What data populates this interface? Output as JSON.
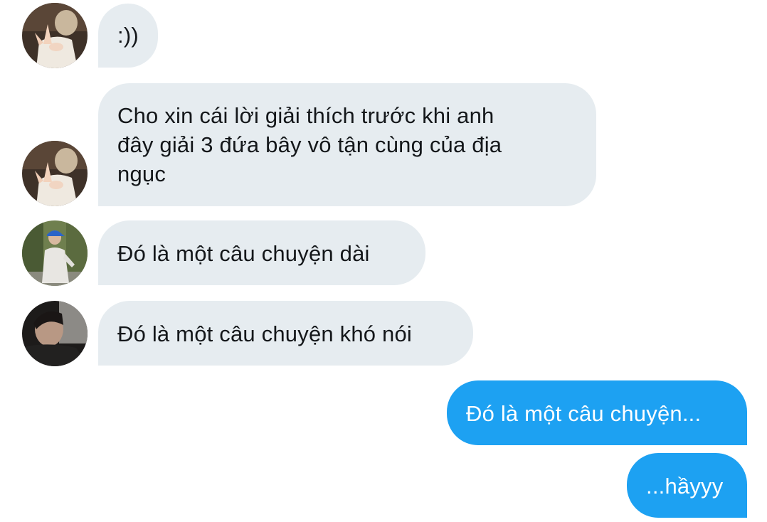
{
  "conversation": {
    "messages": [
      {
        "direction": "incoming",
        "sender_avatar": "avatar-hands",
        "text": ":))"
      },
      {
        "direction": "incoming",
        "sender_avatar": "avatar-hands",
        "text": "Cho xin cái lời giải thích trước khi anh đây giải 3 đứa bây vô tận cùng của địa ngục"
      },
      {
        "direction": "incoming",
        "sender_avatar": "avatar-blue-cap",
        "text": "Đó là một câu chuyện dài"
      },
      {
        "direction": "incoming",
        "sender_avatar": "avatar-dark-portrait",
        "text": "Đó là một câu chuyện khó nói"
      },
      {
        "direction": "outgoing",
        "text": "Đó là một câu chuyện..."
      },
      {
        "direction": "outgoing",
        "text": "...hầyyy"
      }
    ]
  },
  "colors": {
    "incoming_bubble": "#e6ecf0",
    "incoming_text": "#14171a",
    "outgoing_bubble": "#1da1f2",
    "outgoing_text": "#ffffff",
    "background": "#ffffff"
  }
}
